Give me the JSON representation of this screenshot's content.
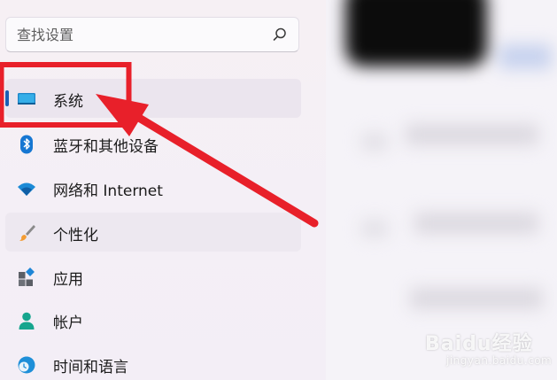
{
  "search": {
    "placeholder": "查找设置"
  },
  "nav": {
    "items": [
      {
        "label": "系统",
        "icon": "monitor-icon"
      },
      {
        "label": "蓝牙和其他设备",
        "icon": "bluetooth-icon"
      },
      {
        "label": "网络和 Internet",
        "icon": "wifi-icon"
      },
      {
        "label": "个性化",
        "icon": "paintbrush-icon"
      },
      {
        "label": "应用",
        "icon": "apps-icon"
      },
      {
        "label": "帐户",
        "icon": "user-icon"
      },
      {
        "label": "时间和语言",
        "icon": "clock-globe-icon"
      }
    ],
    "selected": "系统"
  },
  "colors": {
    "accent": "#1a5fb4",
    "annotation": "#e8202a"
  },
  "watermark": {
    "brand": "Baidu经验",
    "url": "jingyan.baidu.com"
  }
}
